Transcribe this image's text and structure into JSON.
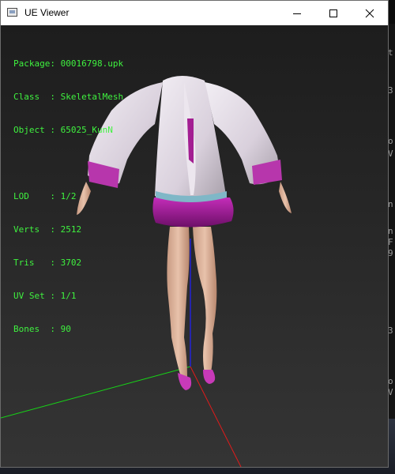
{
  "window": {
    "title": "UE Viewer",
    "icon": "app-icon",
    "controls": {
      "minimize": "minimize-icon",
      "maximize": "maximize-icon",
      "close": "close-icon"
    }
  },
  "info": {
    "package_label": "Package",
    "package_value": "00016798.upk",
    "class_label": "Class",
    "class_value": "SkeletalMesh",
    "object_label": "Object",
    "object_value": "65025_KunN",
    "lod_label": "LOD",
    "lod_value": "1/2",
    "verts_label": "Verts",
    "verts_value": "2512",
    "tris_label": "Tris",
    "tris_value": "3702",
    "uvset_label": "UV Set",
    "uvset_value": "1/1",
    "bones_label": "Bones",
    "bones_value": "90"
  },
  "axes": {
    "x_color": "#e01b1b",
    "y_color": "#17d317",
    "z_color": "#2323d8"
  },
  "colors": {
    "info_text": "#3ff23f",
    "accent_garment": "#b01ea8",
    "jacket": "#e7e0ea"
  }
}
